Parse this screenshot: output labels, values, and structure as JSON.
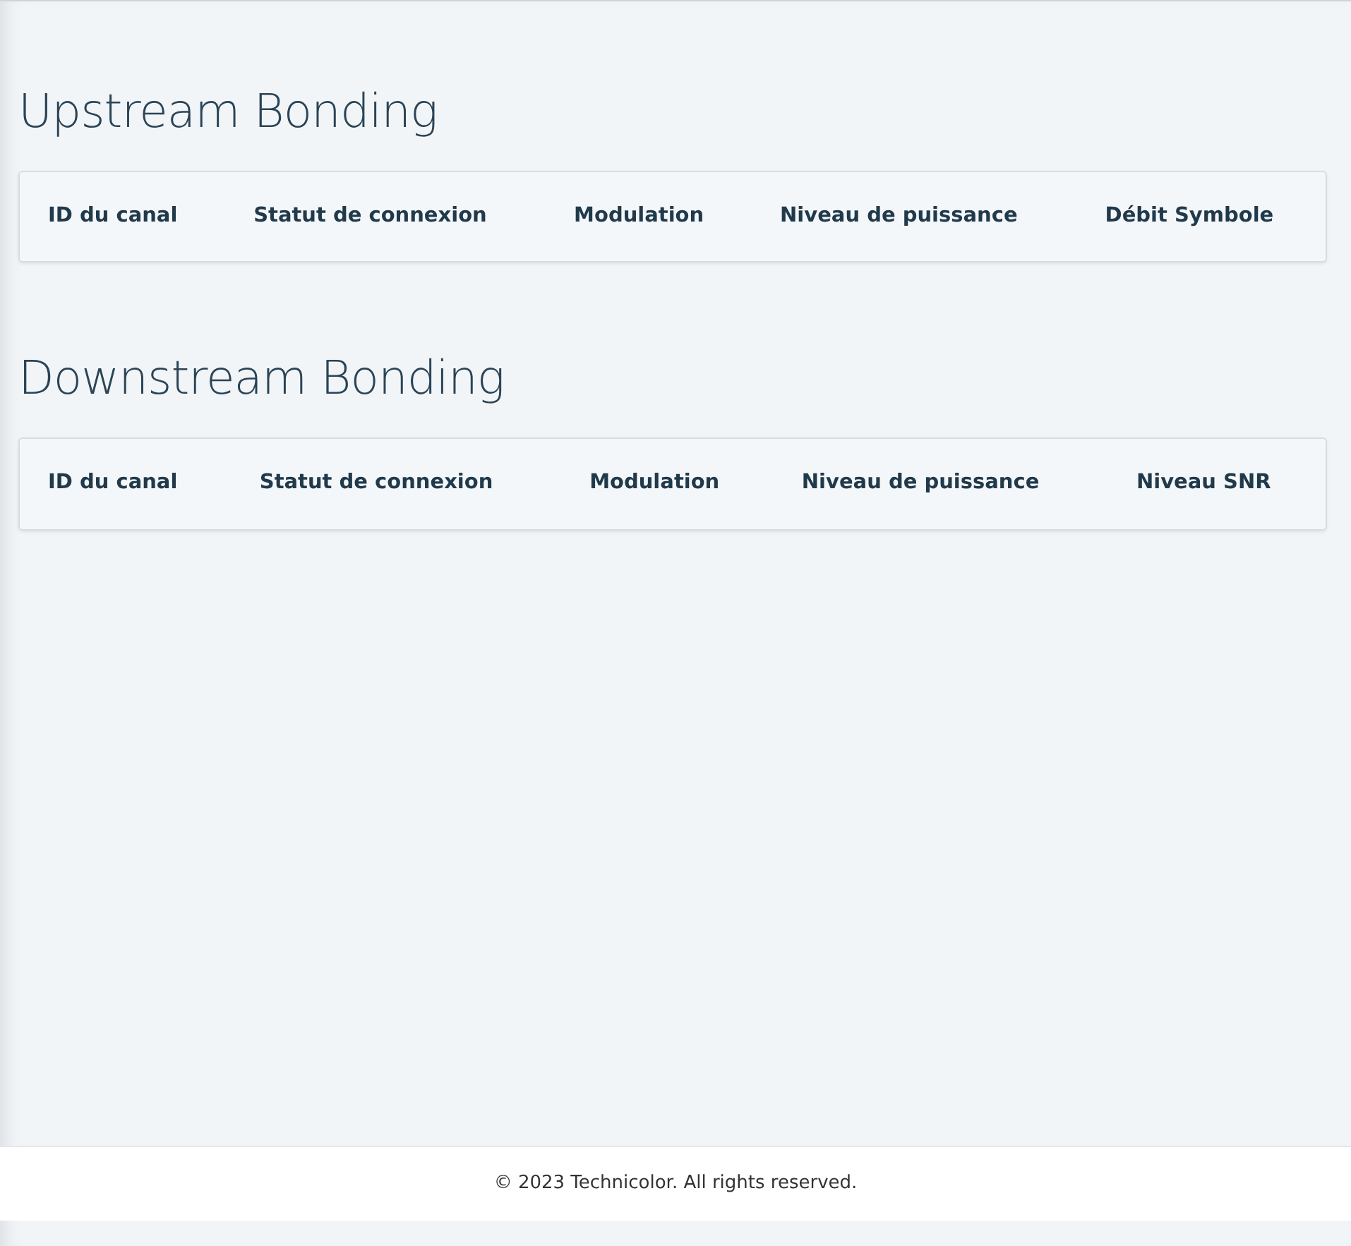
{
  "sections": [
    {
      "title": "Upstream Bonding",
      "columns": [
        "ID du canal",
        "Statut de connexion",
        "Modulation",
        "Niveau de puissance",
        "Débit Symbole"
      ]
    },
    {
      "title": "Downstream Bonding",
      "columns": [
        "ID du canal",
        "Statut de connexion",
        "Modulation",
        "Niveau de puissance",
        "Niveau SNR"
      ]
    }
  ],
  "footer": "© 2023 Technicolor. All rights reserved."
}
